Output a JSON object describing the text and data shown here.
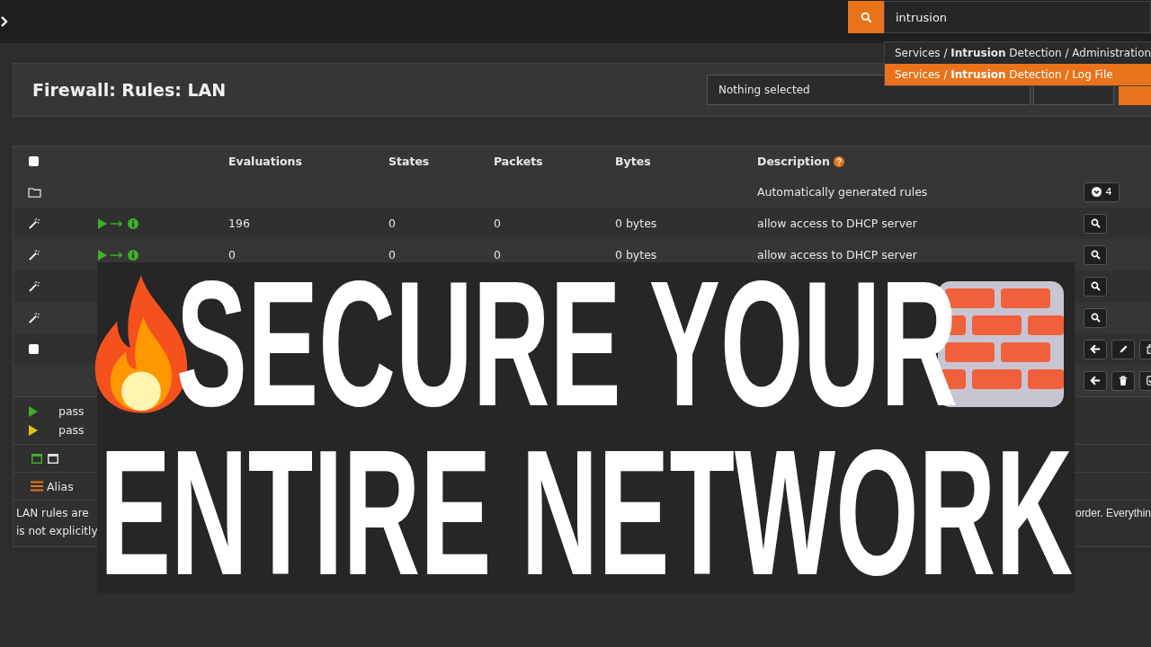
{
  "top_bar": {
    "search_query": "intrusion",
    "results": [
      {
        "text": "Services / **Intrusion** Detection / Administration",
        "selected": false
      },
      {
        "text": "Services / **Intrusion** Detection / Log File",
        "selected": true
      }
    ]
  },
  "page_header": {
    "title": "Firewall: Rules: LAN",
    "select_placeholder": "Nothing selected"
  },
  "rules_table": {
    "select_all_checked": false,
    "columns": [
      "Evaluations",
      "States",
      "Packets",
      "Bytes",
      "Description"
    ],
    "rows": [
      {
        "kind": "group",
        "description": "Automatically generated rules",
        "count": "4"
      },
      {
        "kind": "automatic",
        "status_icons": [
          {
            "kind": "pass"
          },
          {
            "kind": "in"
          },
          {
            "kind": "log"
          }
        ],
        "evaluations": "196",
        "states": "0",
        "packets": "0",
        "bytes": "0 bytes",
        "description": "allow access to DHCP server",
        "actions": [
          {
            "kind": "search"
          }
        ]
      },
      {
        "kind": "automatic",
        "status_icons": [
          {
            "kind": "pass"
          },
          {
            "kind": "in"
          },
          {
            "kind": "log"
          }
        ],
        "evaluations": "0",
        "states": "0",
        "packets": "0",
        "bytes": "0 bytes",
        "description": "allow access to DHCP server",
        "actions": [
          {
            "kind": "search"
          }
        ]
      },
      {
        "kind": "automatic",
        "actions": [
          {
            "kind": "search"
          }
        ]
      },
      {
        "kind": "automatic",
        "actions": [
          {
            "kind": "search"
          }
        ]
      },
      {
        "kind": "user",
        "checked": false,
        "actions": [
          {
            "kind": "arrow-left"
          },
          {
            "kind": "pencil"
          },
          {
            "kind": "copy"
          }
        ]
      },
      {
        "kind": "footer",
        "actions": [
          {
            "kind": "arrow-left"
          },
          {
            "kind": "trash"
          },
          {
            "kind": "check"
          }
        ]
      }
    ]
  },
  "legend": [
    {
      "label": "pass",
      "disabled": false
    },
    {
      "label": "pass",
      "disabled": true
    }
  ],
  "alias_row": {
    "label": "Alias"
  },
  "notes": {
    "left_lines": [
      "LAN rules are",
      "is not explicitly"
    ],
    "right_line": "order. Everythin"
  },
  "overlay": {
    "lines": [
      "SECURE YOUR",
      "ENTIRE NETWORK"
    ]
  }
}
